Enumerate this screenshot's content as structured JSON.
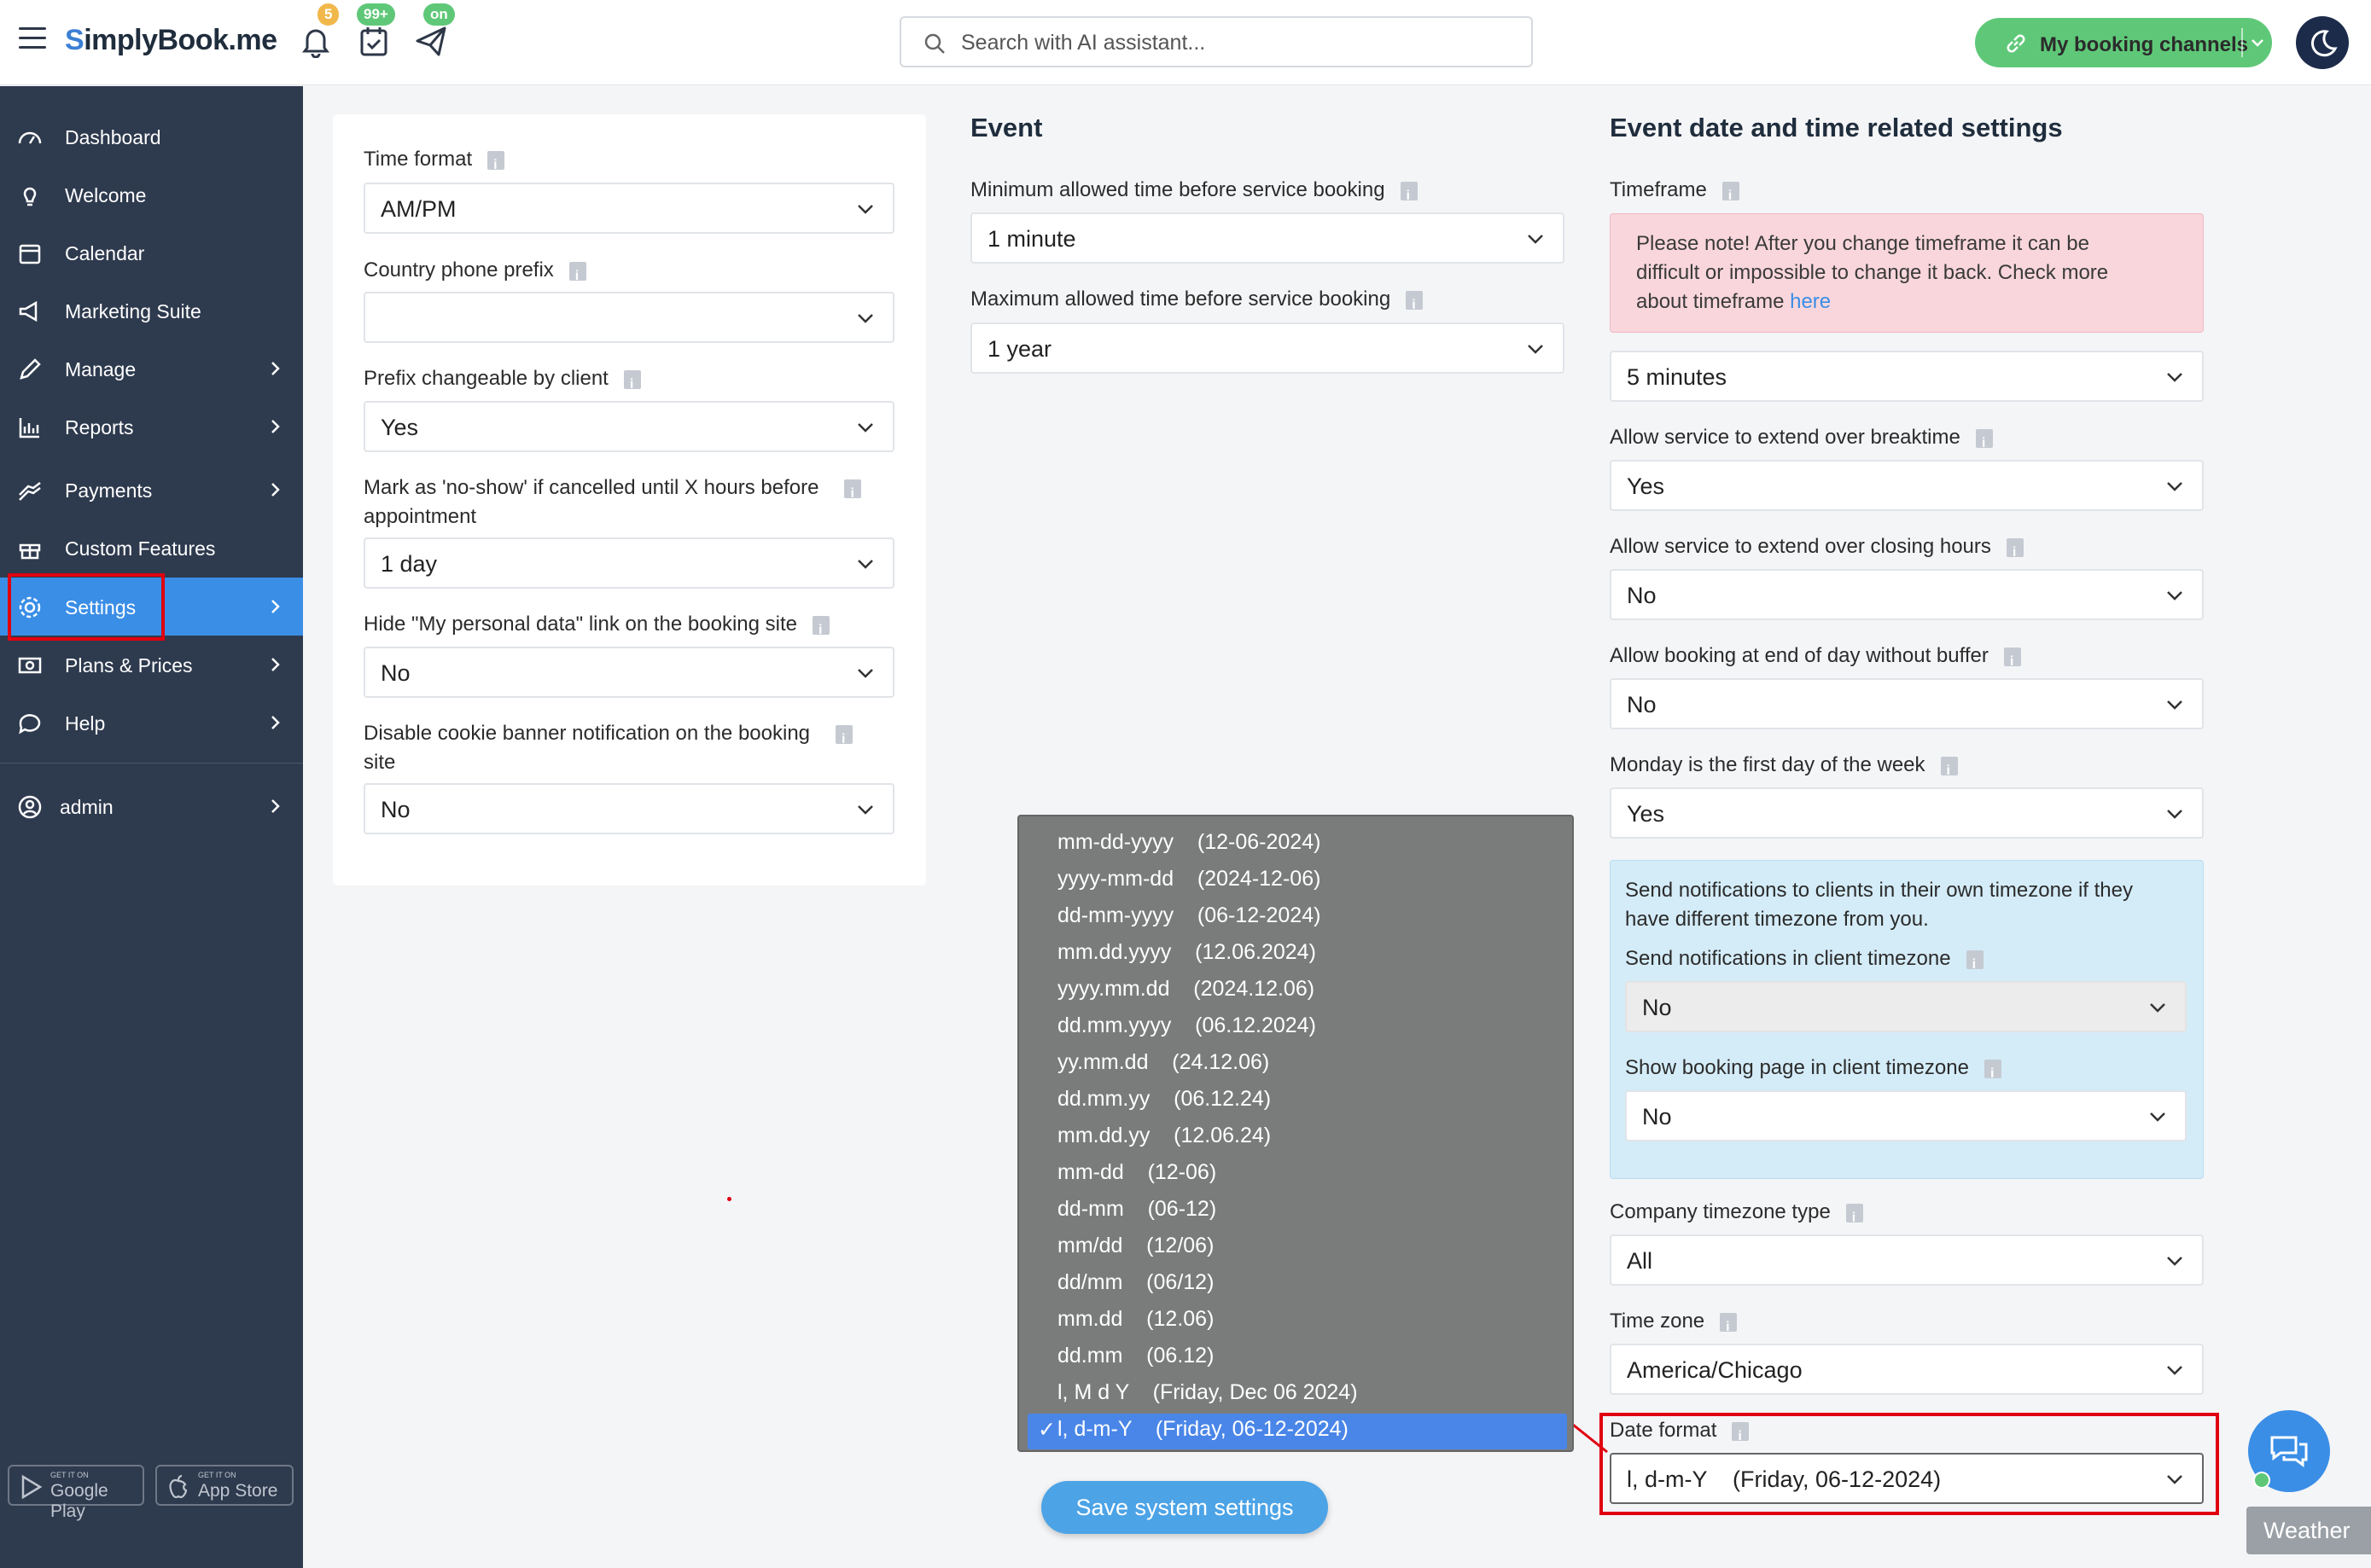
{
  "app": {
    "logo_s": "S",
    "logo_rest": "implyBook.me"
  },
  "topbar": {
    "notif_count": "5",
    "tasks_count": "99+",
    "publish_status": "on",
    "search_placeholder": "Search with AI assistant...",
    "channels_label": "My booking channels"
  },
  "sidebar": {
    "items": [
      {
        "label": "Dashboard",
        "icon": "dashboard-icon"
      },
      {
        "label": "Welcome",
        "icon": "bulb-icon"
      },
      {
        "label": "Calendar",
        "icon": "calendar-icon"
      },
      {
        "label": "Marketing Suite",
        "icon": "megaphone-icon"
      },
      {
        "label": "Manage",
        "icon": "pencil-icon"
      },
      {
        "label": "Reports",
        "icon": "bar-chart-icon"
      },
      {
        "label": "Payments",
        "icon": "money-icon"
      },
      {
        "label": "Custom Features",
        "icon": "gift-icon"
      },
      {
        "label": "Settings",
        "icon": "gear-icon"
      },
      {
        "label": "Plans & Prices",
        "icon": "price-icon"
      },
      {
        "label": "Help",
        "icon": "chat-icon"
      }
    ],
    "user": "admin",
    "google_small": "GET IT ON",
    "google": "Google Play",
    "apple_small": "GET IT ON",
    "apple": "App Store"
  },
  "left": {
    "time_format": {
      "label": "Time format",
      "value": "AM/PM"
    },
    "phone_prefix": {
      "label": "Country phone prefix",
      "value": ""
    },
    "prefix_change": {
      "label": "Prefix changeable by client",
      "value": "Yes"
    },
    "noshow": {
      "label1": "Mark as 'no-show' if cancelled until X hours before",
      "label2": "appointment",
      "value": "1 day"
    },
    "hide_personal": {
      "label": "Hide \"My personal data\" link on the booking site",
      "value": "No"
    },
    "cookie": {
      "label1": "Disable cookie banner notification on the booking",
      "label2": "site",
      "value": "No"
    }
  },
  "event": {
    "title": "Event",
    "min": {
      "label": "Minimum allowed time before service booking",
      "value": "1 minute"
    },
    "max": {
      "label": "Maximum allowed time before service booking",
      "value": "1 year"
    }
  },
  "right": {
    "title": "Event date and time related settings",
    "timeframe": {
      "label": "Timeframe",
      "value": "5 minutes"
    },
    "note": {
      "line1": "Please note! After you change timeframe it can be",
      "line2": "difficult or impossible to change it back. Check more",
      "line3": "about timeframe ",
      "link": "here"
    },
    "breaktime": {
      "label": "Allow service to extend over breaktime",
      "value": "Yes"
    },
    "closing": {
      "label": "Allow service to extend over closing hours",
      "value": "No"
    },
    "endday": {
      "label": "Allow booking at end of day without buffer",
      "value": "No"
    },
    "monday": {
      "label": "Monday is the first day of the week",
      "value": "Yes"
    },
    "tz": {
      "line1": "Send notifications to clients in their own timezone if they",
      "line2": "have different timezone from you.",
      "notif_label": "Send notifications in client timezone",
      "notif_value": "No",
      "page_label": "Show booking page in client timezone",
      "page_value": "No"
    },
    "tz_type": {
      "label": "Company timezone type",
      "value": "All"
    },
    "timezone": {
      "label": "Time zone",
      "value": "America/Chicago"
    },
    "date_format": {
      "label": "Date format",
      "value": "l, d-m-Y    (Friday, 06-12-2024)"
    }
  },
  "dropdown": {
    "options": [
      "mm-dd-yyyy    (12-06-2024)",
      "yyyy-mm-dd    (2024-12-06)",
      "dd-mm-yyyy    (06-12-2024)",
      "mm.dd.yyyy    (12.06.2024)",
      "yyyy.mm.dd    (2024.12.06)",
      "dd.mm.yyyy    (06.12.2024)",
      "yy.mm.dd    (24.12.06)",
      "dd.mm.yy    (06.12.24)",
      "mm.dd.yy    (12.06.24)",
      "mm-dd    (12-06)",
      "dd-mm    (06-12)",
      "mm/dd    (12/06)",
      "dd/mm    (06/12)",
      "mm.dd    (12.06)",
      "dd.mm    (06.12)",
      "l, M d Y    (Friday, Dec 06 2024)",
      "l, d-m-Y    (Friday, 06-12-2024)"
    ],
    "check": "✓"
  },
  "footer": {
    "save": "Save system settings",
    "weather": "Weather"
  },
  "colors": {
    "accent": "#3a8ee6",
    "sidebar": "#2e3a4e",
    "highlight": "#e00010",
    "success": "#5fc878"
  }
}
